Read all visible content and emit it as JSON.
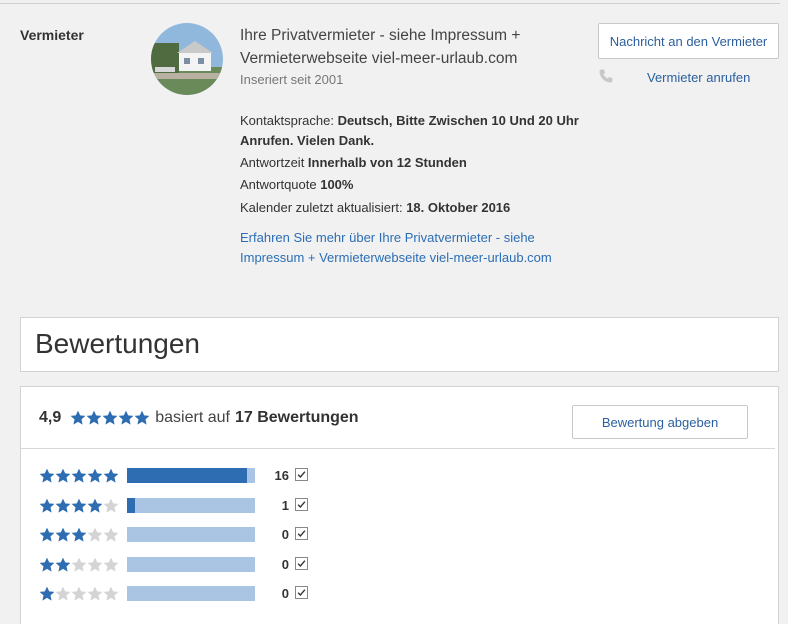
{
  "host": {
    "label": "Vermieter",
    "name": "Ihre Privatvermieter - siehe Impressum + Vermieterwebseite viel-meer-urlaub.com",
    "since": "Inseriert seit 2001",
    "language_label": "Kontaktsprache: ",
    "language_value": "Deutsch, Bitte Zwischen 10 Und 20 Uhr Anrufen. Vielen Dank.",
    "response_time_label": "Antwortzeit ",
    "response_time_value": "Innerhalb von 12 Stunden",
    "response_rate_label": "Antwortquote ",
    "response_rate_value": "100%",
    "calendar_label": "Kalender zuletzt aktualisiert: ",
    "calendar_value": "18. Oktober 2016",
    "more_link": "Erfahren Sie mehr über Ihre Privatvermieter - siehe Impressum + Vermieterwebseite viel-meer-urlaub.com",
    "message_button": "Nachricht an den Vermieter",
    "call_link": "Vermieter anrufen"
  },
  "reviews": {
    "title": "Bewertungen",
    "score": "4,9",
    "based_on": "basiert auf",
    "count_text": "17 Bewertungen",
    "average_stars": 4.9,
    "write_button": "Bewertung abgeben",
    "breakdown": [
      {
        "stars": 5,
        "count": "16",
        "fraction": 0.94
      },
      {
        "stars": 4,
        "count": "1",
        "fraction": 0.06
      },
      {
        "stars": 3,
        "count": "0",
        "fraction": 0
      },
      {
        "stars": 2,
        "count": "0",
        "fraction": 0
      },
      {
        "stars": 1,
        "count": "0",
        "fraction": 0
      }
    ]
  },
  "colors": {
    "accent": "#2b6eb5",
    "star_filled": "#2f6db3",
    "star_empty": "#d4d4d4",
    "bar_empty": "#aac4e4",
    "bar_fill": "#2f6db3"
  },
  "icons": [
    "phone-icon",
    "star-icon",
    "checkbox-icon"
  ]
}
